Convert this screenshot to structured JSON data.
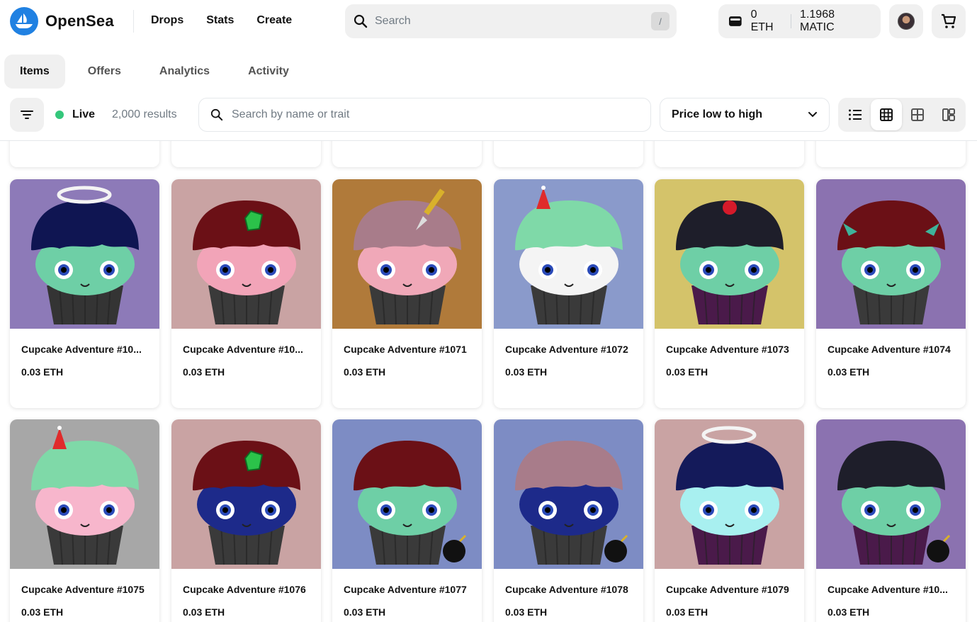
{
  "brand": {
    "name": "OpenSea",
    "color": "#2081e2"
  },
  "nav": {
    "links": [
      "Drops",
      "Stats",
      "Create"
    ]
  },
  "search": {
    "placeholder": "Search",
    "shortcut": "/"
  },
  "wallet": {
    "eth": "0 ETH",
    "matic": "1.1968 MATIC"
  },
  "tabs": [
    "Items",
    "Offers",
    "Analytics",
    "Activity"
  ],
  "filter": {
    "live_label": "Live",
    "results": "2,000 results",
    "trait_placeholder": "Search by name or trait",
    "sort_value": "Price low to high"
  },
  "items": [
    {
      "name": "Cupcake Adventure #10...",
      "price": "0.03 ETH",
      "bg": "#8d7ab8",
      "frosting": "#0f1552",
      "body": "#6ecfa6",
      "wrapper": "#343434",
      "accessory": "halo"
    },
    {
      "name": "Cupcake Adventure #10...",
      "price": "0.03 ETH",
      "bg": "#c9a3a3",
      "frosting": "#6b1016",
      "body": "#f2a4b8",
      "wrapper": "#3a3a3a",
      "accessory": "gem"
    },
    {
      "name": "Cupcake Adventure #1071",
      "price": "0.03 ETH",
      "bg": "#b07a3a",
      "frosting": "#a87c8a",
      "body": "#f0a8b8",
      "wrapper": "#3a3a3a",
      "accessory": "dagger"
    },
    {
      "name": "Cupcake Adventure #1072",
      "price": "0.03 ETH",
      "bg": "#8a9acb",
      "frosting": "#7fd9a8",
      "body": "#f4f4f4",
      "wrapper": "#3a3a3a",
      "accessory": "hat"
    },
    {
      "name": "Cupcake Adventure #1073",
      "price": "0.03 ETH",
      "bg": "#d4c36a",
      "frosting": "#1e1e2a",
      "body": "#6ecfa6",
      "wrapper": "#4a1a4a",
      "accessory": "cherry"
    },
    {
      "name": "Cupcake Adventure #1074",
      "price": "0.03 ETH",
      "bg": "#8b72b0",
      "frosting": "#6b1016",
      "body": "#6ecfa6",
      "wrapper": "#3a3a3a",
      "accessory": "horns"
    },
    {
      "name": "Cupcake Adventure #1075",
      "price": "0.03 ETH",
      "bg": "#a7a7a7",
      "frosting": "#7fd9a8",
      "body": "#f7b6cc",
      "wrapper": "#3a3a3a",
      "accessory": "hat"
    },
    {
      "name": "Cupcake Adventure #1076",
      "price": "0.03 ETH",
      "bg": "#c9a3a3",
      "frosting": "#6b1016",
      "body": "#1d2a8a",
      "wrapper": "#3a3a3a",
      "accessory": "gem"
    },
    {
      "name": "Cupcake Adventure #1077",
      "price": "0.03 ETH",
      "bg": "#7d8cc4",
      "frosting": "#6b1016",
      "body": "#6ecfa6",
      "wrapper": "#3a3a3a",
      "accessory": "bomb"
    },
    {
      "name": "Cupcake Adventure #1078",
      "price": "0.03 ETH",
      "bg": "#7d8cc4",
      "frosting": "#a87c8a",
      "body": "#1d2a8a",
      "wrapper": "#3a3a3a",
      "accessory": "bomb"
    },
    {
      "name": "Cupcake Adventure #1079",
      "price": "0.03 ETH",
      "bg": "#c9a3a3",
      "frosting": "#141a5a",
      "body": "#a8f0f0",
      "wrapper": "#4a1a4a",
      "accessory": "halo"
    },
    {
      "name": "Cupcake Adventure #10...",
      "price": "0.03 ETH",
      "bg": "#8b72b0",
      "frosting": "#1e1e2a",
      "body": "#6ecfa6",
      "wrapper": "#4a1a4a",
      "accessory": "bomb"
    }
  ]
}
